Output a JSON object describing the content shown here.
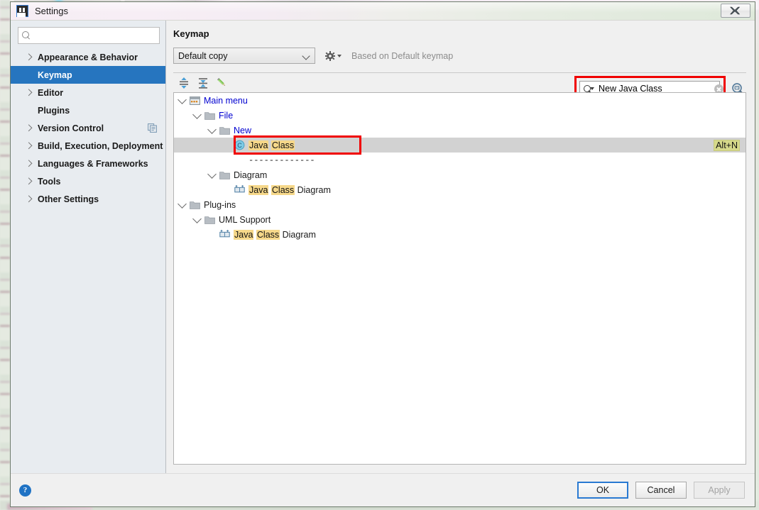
{
  "window": {
    "title": "Settings",
    "app_icon": "intellij-idea-icon",
    "close_label": "Close"
  },
  "sidebar": {
    "search_placeholder": "",
    "search_value": "",
    "search_icon": "search-icon",
    "items": [
      {
        "label": "Appearance & Behavior",
        "expandable": true,
        "selected": false,
        "badge_icon": ""
      },
      {
        "label": "Keymap",
        "expandable": false,
        "selected": true,
        "badge_icon": ""
      },
      {
        "label": "Editor",
        "expandable": true,
        "selected": false,
        "badge_icon": ""
      },
      {
        "label": "Plugins",
        "expandable": false,
        "selected": false,
        "badge_icon": ""
      },
      {
        "label": "Version Control",
        "expandable": true,
        "selected": false,
        "badge_icon": "project-level-icon"
      },
      {
        "label": "Build, Execution, Deployment",
        "expandable": true,
        "selected": false,
        "badge_icon": ""
      },
      {
        "label": "Languages & Frameworks",
        "expandable": true,
        "selected": false,
        "badge_icon": ""
      },
      {
        "label": "Tools",
        "expandable": true,
        "selected": false,
        "badge_icon": ""
      },
      {
        "label": "Other Settings",
        "expandable": true,
        "selected": false,
        "badge_icon": ""
      }
    ]
  },
  "main": {
    "heading": "Keymap",
    "keymap_selected": "Default copy",
    "keymap_dropdown_icon": "chevron-down-icon",
    "gear_icon": "gear-icon",
    "based_on": "Based on Default keymap",
    "toolbar": [
      {
        "name": "expand-all-icon",
        "tooltip": "Expand All"
      },
      {
        "name": "collapse-all-icon",
        "tooltip": "Collapse All"
      },
      {
        "name": "edit-shortcut-icon",
        "tooltip": "Edit Shortcut"
      }
    ],
    "action_search": {
      "value": "New Java Class",
      "placeholder": "",
      "search_icon": "search-dropdown-icon",
      "clear_icon": "clear-icon",
      "shortcut_find_icon": "find-by-shortcut-icon",
      "highlight_color": "#f00000"
    }
  },
  "tree": {
    "rows": [
      {
        "id": "main-menu",
        "depth": 0,
        "expander": "expanded",
        "icon": "main-menu-icon",
        "segments": [
          {
            "t": "Main menu",
            "h": false
          }
        ],
        "color": "blue",
        "shortcut": "",
        "selected": false
      },
      {
        "id": "file",
        "depth": 1,
        "expander": "expanded",
        "icon": "folder-icon",
        "segments": [
          {
            "t": "File",
            "h": false
          }
        ],
        "color": "blue",
        "shortcut": "",
        "selected": false
      },
      {
        "id": "new",
        "depth": 2,
        "expander": "expanded",
        "icon": "folder-icon",
        "segments": [
          {
            "t": "New",
            "h": false
          }
        ],
        "color": "blue",
        "shortcut": "",
        "selected": false
      },
      {
        "id": "java-class",
        "depth": 3,
        "expander": "none",
        "icon": "java-class-icon",
        "segments": [
          {
            "t": "Java",
            "h": true
          },
          {
            "t": " ",
            "h": false
          },
          {
            "t": "Class",
            "h": true
          }
        ],
        "color": "black",
        "shortcut": "Alt+N",
        "selected": true
      },
      {
        "id": "separator",
        "depth": 3,
        "expander": "none",
        "icon": "none",
        "segments": [
          {
            "t": "-------------",
            "h": false
          }
        ],
        "color": "black",
        "shortcut": "",
        "selected": false
      },
      {
        "id": "diagram-grp",
        "depth": 2,
        "expander": "expanded",
        "icon": "folder-icon",
        "segments": [
          {
            "t": "Diagram",
            "h": false
          }
        ],
        "color": "black",
        "shortcut": "",
        "selected": false
      },
      {
        "id": "jcd-1",
        "depth": 3,
        "expander": "none",
        "icon": "diagram-icon",
        "segments": [
          {
            "t": "Java",
            "h": true
          },
          {
            "t": " ",
            "h": false
          },
          {
            "t": "Class",
            "h": true
          },
          {
            "t": " Diagram",
            "h": false
          }
        ],
        "color": "black",
        "shortcut": "",
        "selected": false
      },
      {
        "id": "plug-ins",
        "depth": 0,
        "expander": "expanded",
        "icon": "folder-icon",
        "segments": [
          {
            "t": "Plug-ins",
            "h": false
          }
        ],
        "color": "black",
        "shortcut": "",
        "selected": false
      },
      {
        "id": "uml-support",
        "depth": 1,
        "expander": "expanded",
        "icon": "folder-icon",
        "segments": [
          {
            "t": "UML Support",
            "h": false
          }
        ],
        "color": "black",
        "shortcut": "",
        "selected": false
      },
      {
        "id": "jcd-2",
        "depth": 2,
        "expander": "none",
        "icon": "diagram-icon",
        "segments": [
          {
            "t": "Java",
            "h": true
          },
          {
            "t": " ",
            "h": false
          },
          {
            "t": "Class",
            "h": true
          },
          {
            "t": " Diagram",
            "h": false
          }
        ],
        "color": "black",
        "shortcut": "",
        "selected": false
      }
    ],
    "match_highlight_color": "#f6d88a",
    "shortcut_highlight_color": "#d6d98a",
    "selection_color": "#d2d2d2"
  },
  "footer": {
    "help_label": "?",
    "ok_label": "OK",
    "cancel_label": "Cancel",
    "apply_label": "Apply",
    "apply_disabled": true
  },
  "colors": {
    "accent_blue": "#2675bf",
    "annotation_red": "#f00000",
    "tree_node_blue": "#0000d0"
  }
}
